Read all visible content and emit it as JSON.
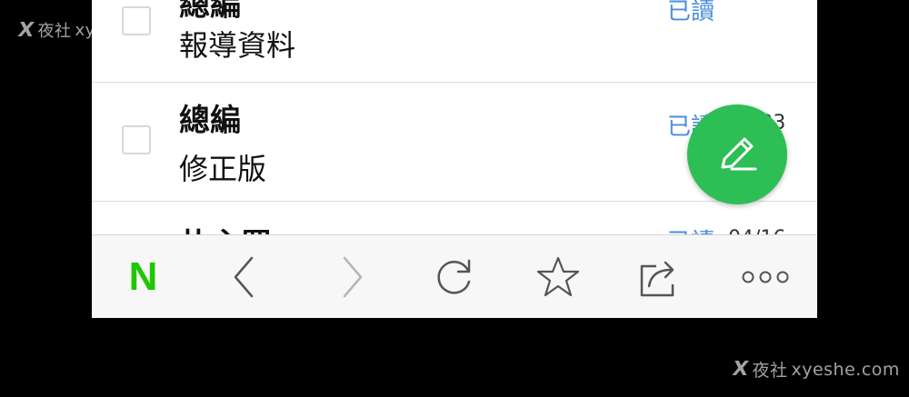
{
  "watermark": {
    "prefix": "夜社",
    "site": "xyeshe.com"
  },
  "mail_list": {
    "rows": [
      {
        "sender": "總編",
        "subject": "報導資料",
        "read_status": "已讀",
        "date": ""
      },
      {
        "sender": "總編",
        "subject": "修正版",
        "read_status": "已讀",
        "date": "04/23"
      },
      {
        "sender": "朴主羅",
        "subject": "",
        "read_status": "已讀",
        "date": "04/16"
      }
    ]
  },
  "compose_button": {
    "icon": "pencil-icon",
    "color": "#2dbe55"
  },
  "toolbar": {
    "logo_text": "N",
    "logo_color": "#1ec800",
    "items": [
      {
        "icon": "naver-logo"
      },
      {
        "icon": "back-arrow-icon"
      },
      {
        "icon": "forward-arrow-icon"
      },
      {
        "icon": "refresh-icon"
      },
      {
        "icon": "star-icon"
      },
      {
        "icon": "share-icon"
      },
      {
        "icon": "more-icon"
      }
    ]
  },
  "colors": {
    "read_status": "#4a8fd6",
    "background": "#000000",
    "toolbar_bg": "#f7f7f7"
  }
}
